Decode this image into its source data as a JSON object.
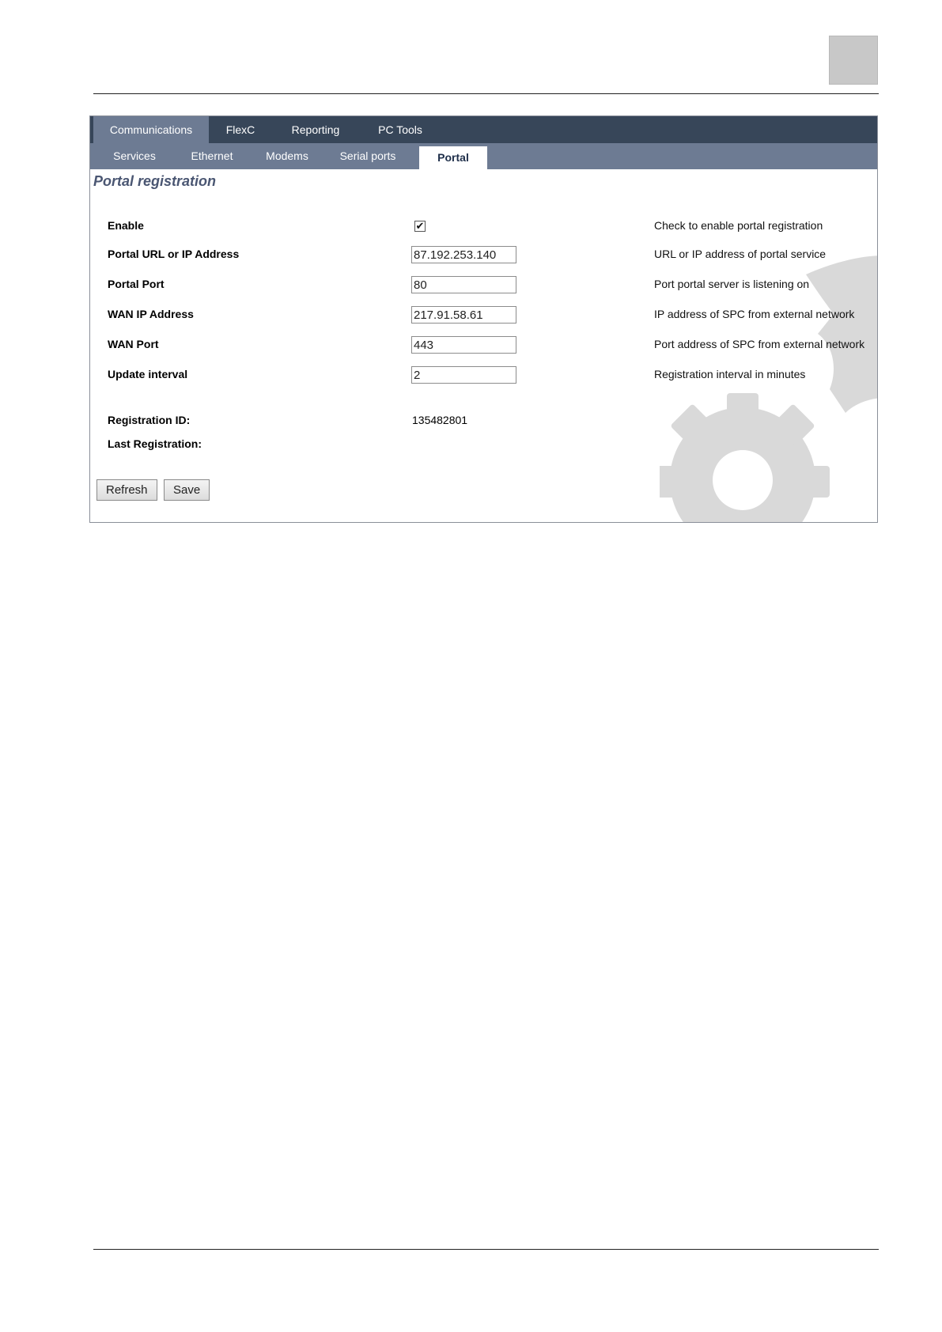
{
  "tabs_main": [
    {
      "label": "Communications",
      "active": true
    },
    {
      "label": "FlexC",
      "active": false
    },
    {
      "label": "Reporting",
      "active": false
    },
    {
      "label": "PC Tools",
      "active": false
    }
  ],
  "tabs_sub": [
    {
      "label": "Services",
      "active": false
    },
    {
      "label": "Ethernet",
      "active": false
    },
    {
      "label": "Modems",
      "active": false
    },
    {
      "label": "Serial ports",
      "active": false
    },
    {
      "label": "Portal",
      "active": true
    }
  ],
  "page_title": "Portal registration",
  "fields": {
    "enable": {
      "label": "Enable",
      "checked": true,
      "description": "Check to enable portal registration"
    },
    "portal_url": {
      "label": "Portal URL or IP Address",
      "value": "87.192.253.140",
      "description": "URL or IP address of portal service"
    },
    "portal_port": {
      "label": "Portal Port",
      "value": "80",
      "description": "Port portal server is listening on"
    },
    "wan_ip": {
      "label": "WAN IP Address",
      "value": "217.91.58.61",
      "description": "IP address of SPC from external network"
    },
    "wan_port": {
      "label": "WAN Port",
      "value": "443",
      "description": "Port address of SPC from external network"
    },
    "update_interval": {
      "label": "Update interval",
      "value": "2",
      "description": "Registration interval in minutes"
    }
  },
  "registration": {
    "id_label": "Registration ID:",
    "id_value": "135482801",
    "last_label": "Last Registration:"
  },
  "buttons": {
    "refresh": "Refresh",
    "save": "Save"
  },
  "icons": {
    "checkmark": "✔",
    "background_decoration": "gear-icon"
  },
  "colors": {
    "main_tab_bar": "#374659",
    "sub_tab_bar": "#6d7b93",
    "title": "#4a5672",
    "gear": "#d9d9d9"
  }
}
